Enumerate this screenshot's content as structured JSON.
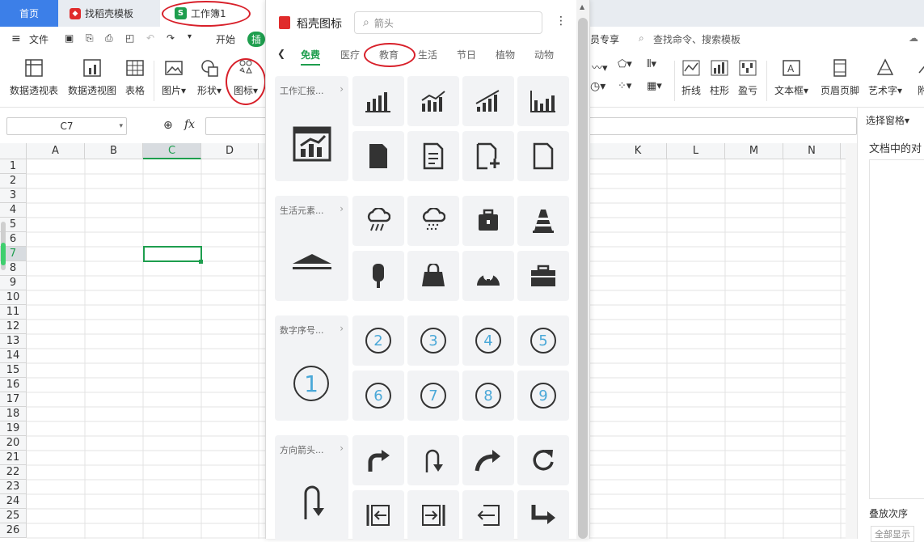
{
  "tabs": {
    "home": "首页",
    "template": "找稻壳模板",
    "book": "工作簿1"
  },
  "menu": {
    "file": "文件",
    "start": "开始",
    "insert_short": "插",
    "member": "员专享",
    "search": "查找命令、搜索模板"
  },
  "ribbon": {
    "pivot_table": "数据透视表",
    "pivot_chart": "数据透视图",
    "table": "表格",
    "picture": "图片",
    "shape": "形状",
    "icon": "图标",
    "line": "折线",
    "column": "柱形",
    "winloss": "盈亏",
    "textbox": "文本框",
    "headerfooter": "页眉页脚",
    "wordart": "艺术字",
    "attach": "附"
  },
  "formula": {
    "cell_ref": "C7",
    "fx": "fx"
  },
  "columns": [
    "A",
    "B",
    "C",
    "D",
    "K",
    "L",
    "M",
    "N"
  ],
  "rows": [
    "1",
    "2",
    "3",
    "4",
    "5",
    "6",
    "7",
    "8",
    "9",
    "10",
    "11",
    "12",
    "13",
    "14",
    "15",
    "16",
    "17",
    "18",
    "19",
    "20",
    "21",
    "22",
    "23",
    "24",
    "25",
    "26"
  ],
  "right_pane": {
    "select_pane": "选择窗格",
    "doc_objects": "文档中的对",
    "stack_order": "叠放次序",
    "show_all": "全部显示"
  },
  "panel": {
    "title": "稻壳图标",
    "search_placeholder": "箭头",
    "more": "⋮",
    "categories": [
      "免费",
      "医疗",
      "教育",
      "生活",
      "节日",
      "植物",
      "动物"
    ],
    "sections": [
      {
        "label": "工作汇报..."
      },
      {
        "label": "生活元素..."
      },
      {
        "label": "数字序号..."
      },
      {
        "label": "方向箭头..."
      }
    ],
    "numbers": [
      "2",
      "3",
      "4",
      "5",
      "6",
      "7",
      "8",
      "9"
    ],
    "big_number": "1"
  },
  "colors": {
    "accent": "#1e9e4e",
    "tab_blue": "#3c7fe8",
    "annotation_red": "#d8202a",
    "icon_dark": "#333333",
    "number_blue": "#4aa8d8"
  }
}
